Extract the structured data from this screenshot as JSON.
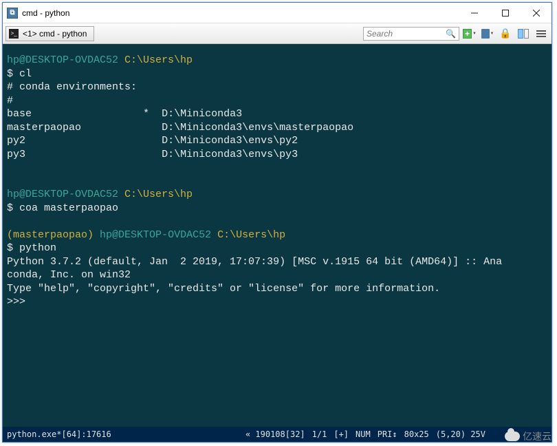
{
  "window": {
    "title": "cmd - python",
    "app_glyph": "⧉"
  },
  "toolbar": {
    "tab_label": "<1> cmd - python",
    "search_placeholder": "Search"
  },
  "terminal": {
    "host": "hp@DESKTOP-OVDAC52",
    "path": "C:\\Users\\hp",
    "cmd1": "$ cl",
    "env_header": "# conda environments:",
    "hash": "#",
    "envs": [
      {
        "name": "base",
        "active": "*",
        "path": "D:\\Miniconda3"
      },
      {
        "name": "masterpaopao",
        "active": " ",
        "path": "D:\\Miniconda3\\envs\\masterpaopao"
      },
      {
        "name": "py2",
        "active": " ",
        "path": "D:\\Miniconda3\\envs\\py2"
      },
      {
        "name": "py3",
        "active": " ",
        "path": "D:\\Miniconda3\\envs\\py3"
      }
    ],
    "cmd2": "$ coa masterpaopao",
    "env_prefix": "(masterpaopao)",
    "cmd3": "$ python",
    "py_line1": "Python 3.7.2 (default, Jan  2 2019, 17:07:39) [MSC v.1915 64 bit (AMD64)] :: Ana",
    "py_line2": "conda, Inc. on win32",
    "py_line3": "Type \"help\", \"copyright\", \"credits\" or \"license\" for more information.",
    "repl": ">>>"
  },
  "status": {
    "proc": "python.exe*[64]:17616",
    "date": "« 190108[32]",
    "pos": "1/1",
    "plus": "[+]",
    "num": "NUM",
    "pri": "PRI↕",
    "size": "80x25",
    "cursor": "(5,20) 25V"
  },
  "watermark": {
    "text": "亿速云"
  }
}
